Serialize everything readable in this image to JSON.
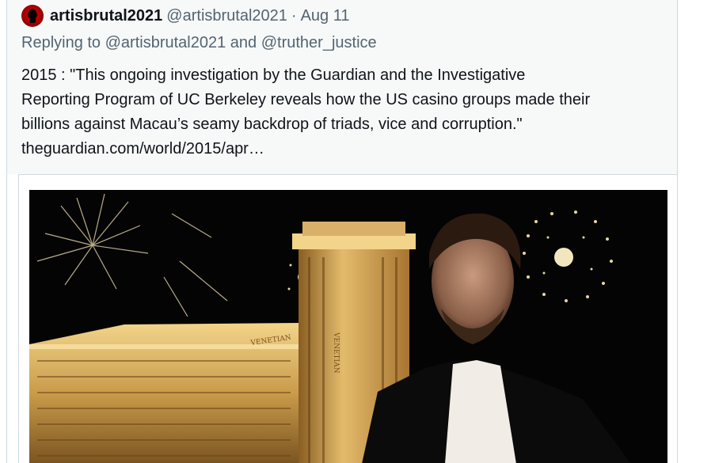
{
  "tweet": {
    "display_name": "artisbrutal2021",
    "handle": "@artisbrutal2021",
    "separator": "·",
    "date": "Aug 11",
    "replying_prefix": "Replying to",
    "reply_to_1": "@artisbrutal2021",
    "reply_and": "and",
    "reply_to_2": "@truther_justice",
    "text_line_1": "2015 : \"This ongoing investigation by the Guardian and the Investigative",
    "text_line_2": "Reporting Program of UC Berkeley reveals how the US casino groups made their",
    "text_line_3": "billions against Macau’s seamy backdrop of triads, vice and corruption.\"",
    "link": "theguardian.com/world/2015/apr…"
  },
  "media": {
    "description_icon": "photo-icon",
    "sign_1": "VENETIAN",
    "sign_2": "VENETIAN"
  }
}
